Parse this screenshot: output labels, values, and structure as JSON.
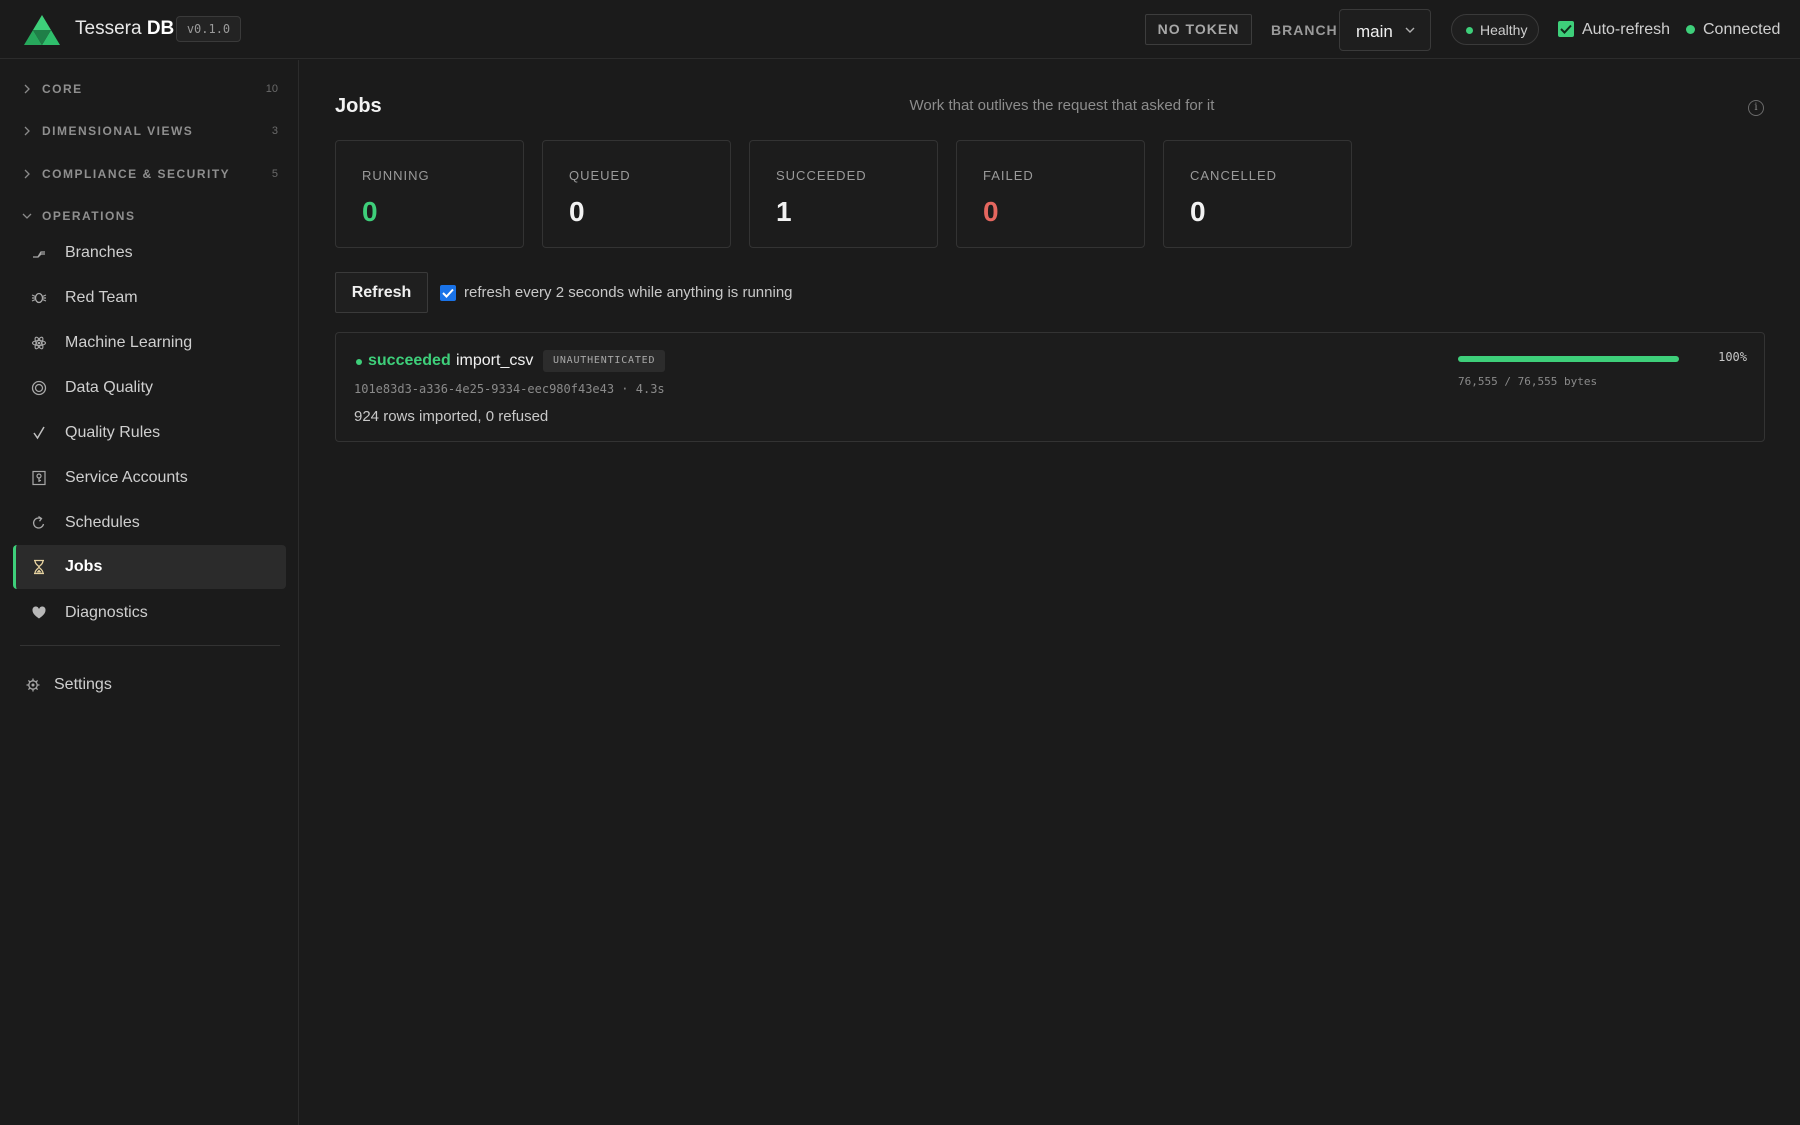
{
  "header": {
    "brand_name": "Tessera",
    "brand_suffix": "DB",
    "version": "v0.1.0",
    "token_button": "NO TOKEN",
    "branch_label": "BRANCH",
    "branch_value": "main",
    "health_status": "Healthy",
    "auto_refresh_label": "Auto-refresh",
    "auto_refresh_checked": true,
    "connection_status": "Connected"
  },
  "sidebar": {
    "groups": [
      {
        "label": "CORE",
        "count": "10",
        "expanded": false
      },
      {
        "label": "DIMENSIONAL VIEWS",
        "count": "3",
        "expanded": false
      },
      {
        "label": "COMPLIANCE & SECURITY",
        "count": "5",
        "expanded": false
      },
      {
        "label": "OPERATIONS",
        "count": "",
        "expanded": true
      }
    ],
    "items": [
      {
        "label": "Branches",
        "icon": "branch-icon"
      },
      {
        "label": "Red Team",
        "icon": "bug-icon"
      },
      {
        "label": "Machine Learning",
        "icon": "atom-icon"
      },
      {
        "label": "Data Quality",
        "icon": "target-icon"
      },
      {
        "label": "Quality Rules",
        "icon": "check-icon"
      },
      {
        "label": "Service Accounts",
        "icon": "key-icon"
      },
      {
        "label": "Schedules",
        "icon": "refresh-icon"
      },
      {
        "label": "Jobs",
        "icon": "hourglass-icon",
        "active": true
      },
      {
        "label": "Diagnostics",
        "icon": "heart-icon"
      }
    ],
    "settings_label": "Settings"
  },
  "main": {
    "title": "Jobs",
    "subtitle": "Work that outlives the request that asked for it",
    "stats": [
      {
        "label": "RUNNING",
        "value": "0",
        "color": "#3ecf7a"
      },
      {
        "label": "QUEUED",
        "value": "0",
        "color": "#f2f2f2"
      },
      {
        "label": "SUCCEEDED",
        "value": "1",
        "color": "#f2f2f2"
      },
      {
        "label": "FAILED",
        "value": "0",
        "color": "#e5675f"
      },
      {
        "label": "CANCELLED",
        "value": "0",
        "color": "#f2f2f2"
      }
    ],
    "refresh_label": "Refresh",
    "poll_label": "refresh every 2 seconds while anything is running",
    "poll_checked": true,
    "jobs": [
      {
        "status": "succeeded",
        "kind": "import_csv",
        "badge": "UNAUTHENTICATED",
        "meta": "101e83d3-a336-4e25-9334-eec980f43e43 · 4.3s",
        "result": "924 rows imported, 0 refused",
        "progress_fraction": 1.0,
        "progress_pct": "100%",
        "progress_bytes": "76,555 / 76,555 bytes"
      }
    ]
  },
  "colors": {
    "accent": "#3ecf7a",
    "danger": "#e5675f",
    "checkbox_blue": "#1a73e8"
  }
}
